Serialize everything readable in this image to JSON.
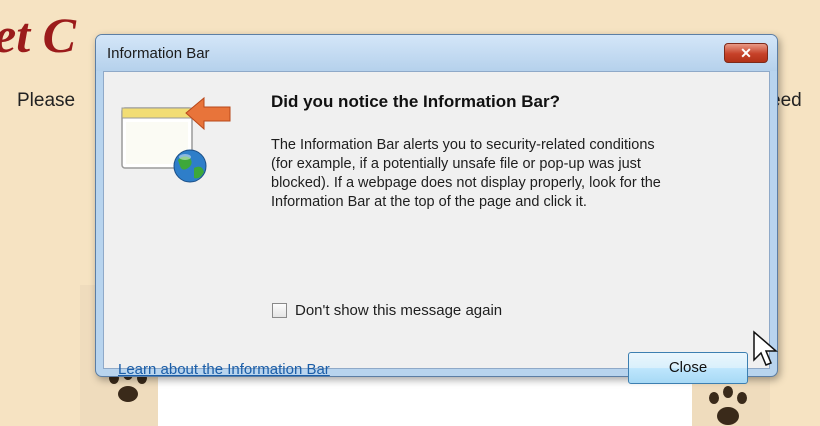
{
  "background": {
    "title_fragment": "et C",
    "left_text": "Please",
    "right_text": "eed"
  },
  "dialog": {
    "title": "Information Bar",
    "close_glyph": "✕",
    "heading": "Did you notice the Information Bar?",
    "body_lines": [
      "The Information Bar alerts you to security-related conditions",
      "(for example, if a potentially unsafe file or pop-up was just",
      "blocked). If a webpage does not display properly, look for the",
      "Information Bar at the top of the page and click it."
    ],
    "checkbox": {
      "label": "Don't show this message again",
      "checked": false
    },
    "link": "Learn about the Information Bar",
    "close_button": "Close",
    "illustration": "information-bar-icon"
  },
  "colors": {
    "page_background": "#f6e3c2",
    "title_red": "#9b1b1b",
    "dialog_frame": "#b8d4ee",
    "link_blue": "#1b5ea8",
    "close_red": "#c64128"
  }
}
